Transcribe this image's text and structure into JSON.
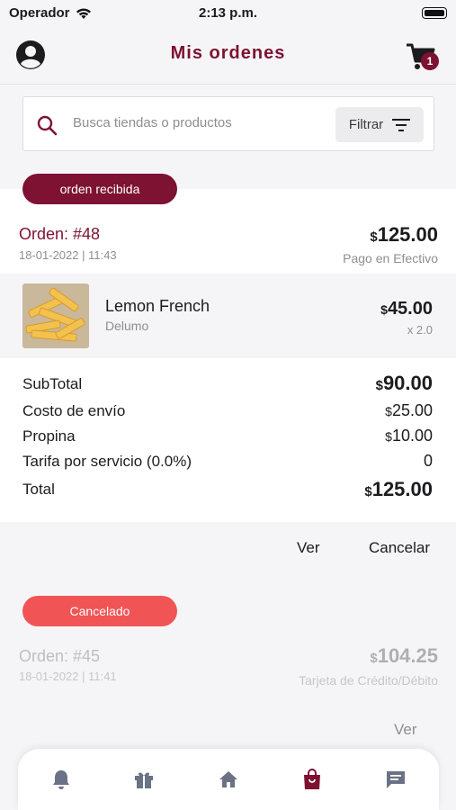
{
  "status_bar": {
    "carrier": "Operador",
    "time": "2:13 p.m."
  },
  "header": {
    "title": "Mis ordenes",
    "cart_count": "1"
  },
  "search": {
    "placeholder": "Busca tiendas o productos",
    "filter_label": "Filtrar"
  },
  "orders": [
    {
      "status": "orden recibida",
      "title": "Orden: #48",
      "date": "18-01-2022 | 11:43",
      "currency": "$",
      "total": "125.00",
      "payment": "Pago en Efectivo",
      "items": [
        {
          "name": "Lemon French",
          "store": "Delumo",
          "currency": "$",
          "price": "45.00",
          "qty": "x 2.0"
        }
      ],
      "summary": [
        {
          "label": "SubTotal",
          "currency": "$",
          "value": "90.00"
        },
        {
          "label": "Costo de envío",
          "currency": "$",
          "value": "25.00"
        },
        {
          "label": "Propina",
          "currency": "$",
          "value": "10.00"
        },
        {
          "label": "Tarifa por servicio (0.0%)",
          "currency": "",
          "value": "0"
        },
        {
          "label": "Total",
          "currency": "$",
          "value": "125.00"
        }
      ],
      "actions": {
        "view": "Ver",
        "cancel": "Cancelar"
      }
    },
    {
      "status": "Cancelado",
      "title": "Orden: #45",
      "date": "18-01-2022 | 11:41",
      "currency": "$",
      "total": "104.25",
      "payment": "Tarjeta de Crédito/Débito",
      "actions": {
        "view": "Ver"
      }
    }
  ],
  "bottom_nav": [
    {
      "icon": "bell-icon",
      "active": false
    },
    {
      "icon": "gift-icon",
      "active": false
    },
    {
      "icon": "home-icon",
      "active": false
    },
    {
      "icon": "shopping-bag-icon",
      "active": true
    },
    {
      "icon": "chat-icon",
      "active": false
    }
  ],
  "colors": {
    "brand": "#7d1232",
    "cancelled": "#f15454",
    "nav_inactive": "#6b7285"
  }
}
